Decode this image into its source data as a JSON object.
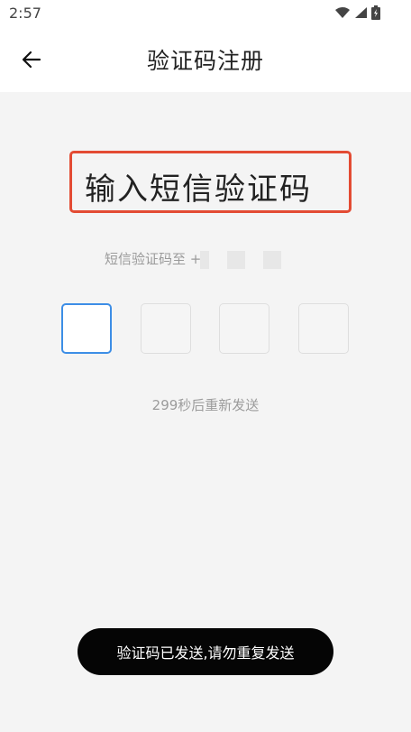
{
  "status_bar": {
    "time": "2:57",
    "icons": [
      "wifi-icon",
      "signal-icon",
      "battery-icon"
    ]
  },
  "nav": {
    "back_icon": "arrow-left-icon",
    "title": "验证码注册"
  },
  "main": {
    "heading": "输入短信验证码",
    "sent_to_label": "短信验证码至 +",
    "resend_text": "299秒后重新发送"
  },
  "toast": {
    "text": "验证码已发送,请勿重复发送"
  },
  "colors": {
    "accent": "#3d8ee6",
    "highlight_border": "#e34b33"
  }
}
